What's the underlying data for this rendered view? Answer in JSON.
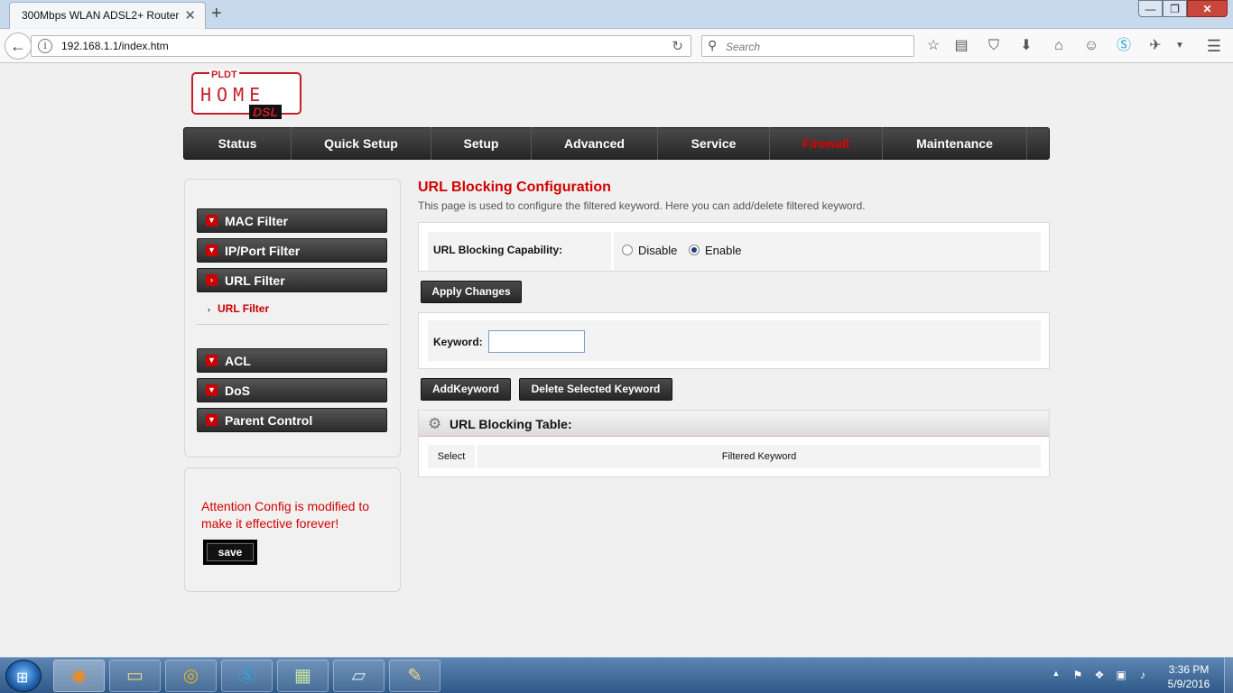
{
  "browser": {
    "tab_title": "300Mbps WLAN ADSL2+ Router",
    "tab_close": "✕",
    "new_tab": "+",
    "url": "192.168.1.1/index.htm",
    "search_placeholder": "Search",
    "window_min": "—",
    "window_max": "❐",
    "window_close": "✕"
  },
  "logo": {
    "pldt": "PLDT",
    "home": "HOME",
    "dsl": "DSL"
  },
  "nav": {
    "items": [
      "Status",
      "Quick Setup",
      "Setup",
      "Advanced",
      "Service",
      "Firewall",
      "Maintenance"
    ],
    "active": "Firewall"
  },
  "sidebar": {
    "items": [
      "MAC Filter",
      "IP/Port Filter",
      "URL Filter",
      "ACL",
      "DoS",
      "Parent Control"
    ],
    "active": "URL Filter",
    "sub_item": "URL Filter"
  },
  "notice": {
    "text": "Attention Config is modified to make it effective forever!",
    "save_label": "save"
  },
  "content": {
    "title": "URL Blocking Configuration",
    "description": "This page is used to configure the filtered keyword. Here you can add/delete filtered keyword.",
    "capability_label": "URL Blocking Capability:",
    "option_disable": "Disable",
    "option_enable": "Enable",
    "selected_option": "Enable",
    "apply_label": "Apply Changes",
    "keyword_label": "Keyword:",
    "keyword_value": "",
    "add_keyword_label": "AddKeyword",
    "delete_keyword_label": "Delete Selected Keyword",
    "table_title": "URL Blocking Table:",
    "table_columns": [
      "Select",
      "Filtered Keyword"
    ]
  },
  "taskbar": {
    "time": "3:36 PM",
    "date": "5/9/2016"
  },
  "colors": {
    "accent_red": "#d40000",
    "nav_dark": "#262626"
  }
}
